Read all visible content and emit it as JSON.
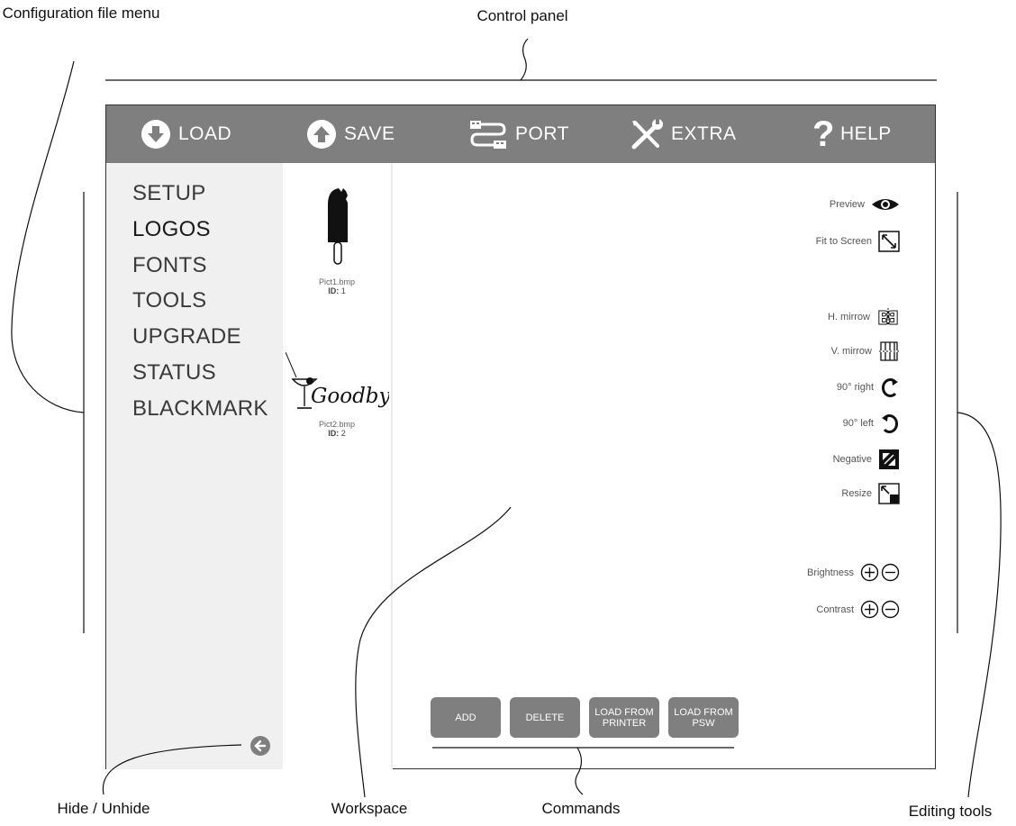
{
  "callouts": {
    "config_menu": "Configuration file menu",
    "control_panel": "Control panel",
    "hide_unhide": "Hide / Unhide",
    "workspace": "Workspace",
    "commands": "Commands",
    "editing_tools": "Editing tools"
  },
  "toolbar": {
    "load": "LOAD",
    "save": "SAVE",
    "port": "PORT",
    "extra": "EXTRA",
    "help": "HELP"
  },
  "sidebar": {
    "items": [
      {
        "label": "SETUP",
        "active": false
      },
      {
        "label": "LOGOS",
        "active": true
      },
      {
        "label": "FONTS",
        "active": false
      },
      {
        "label": "TOOLS",
        "active": false
      },
      {
        "label": "UPGRADE",
        "active": false
      },
      {
        "label": "STATUS",
        "active": false
      },
      {
        "label": "BLACKMARK",
        "active": false
      }
    ]
  },
  "thumbnails": [
    {
      "file": "Pict1.bmp",
      "id_label": "ID:",
      "id": "1"
    },
    {
      "file": "Pict2.bmp",
      "id_label": "ID:",
      "id": "2",
      "art_text": "Goodbye"
    }
  ],
  "tools": {
    "preview": "Preview",
    "fit": "Fit to Screen",
    "hmirror": "H. mirrow",
    "vmirror": "V. mirrow",
    "rot_right": "90° right",
    "rot_left": "90° left",
    "negative": "Negative",
    "resize": "Resize",
    "brightness": "Brightness",
    "contrast": "Contrast"
  },
  "commands": {
    "add": "ADD",
    "delete": "DELETE",
    "load_printer": "LOAD FROM\nPRINTER",
    "load_psw": "LOAD FROM\nPSW"
  },
  "colors": {
    "toolbar_bg": "#7f7f7f",
    "sidebar_bg": "#f0f0f0",
    "button_bg": "#7f7f7f"
  }
}
